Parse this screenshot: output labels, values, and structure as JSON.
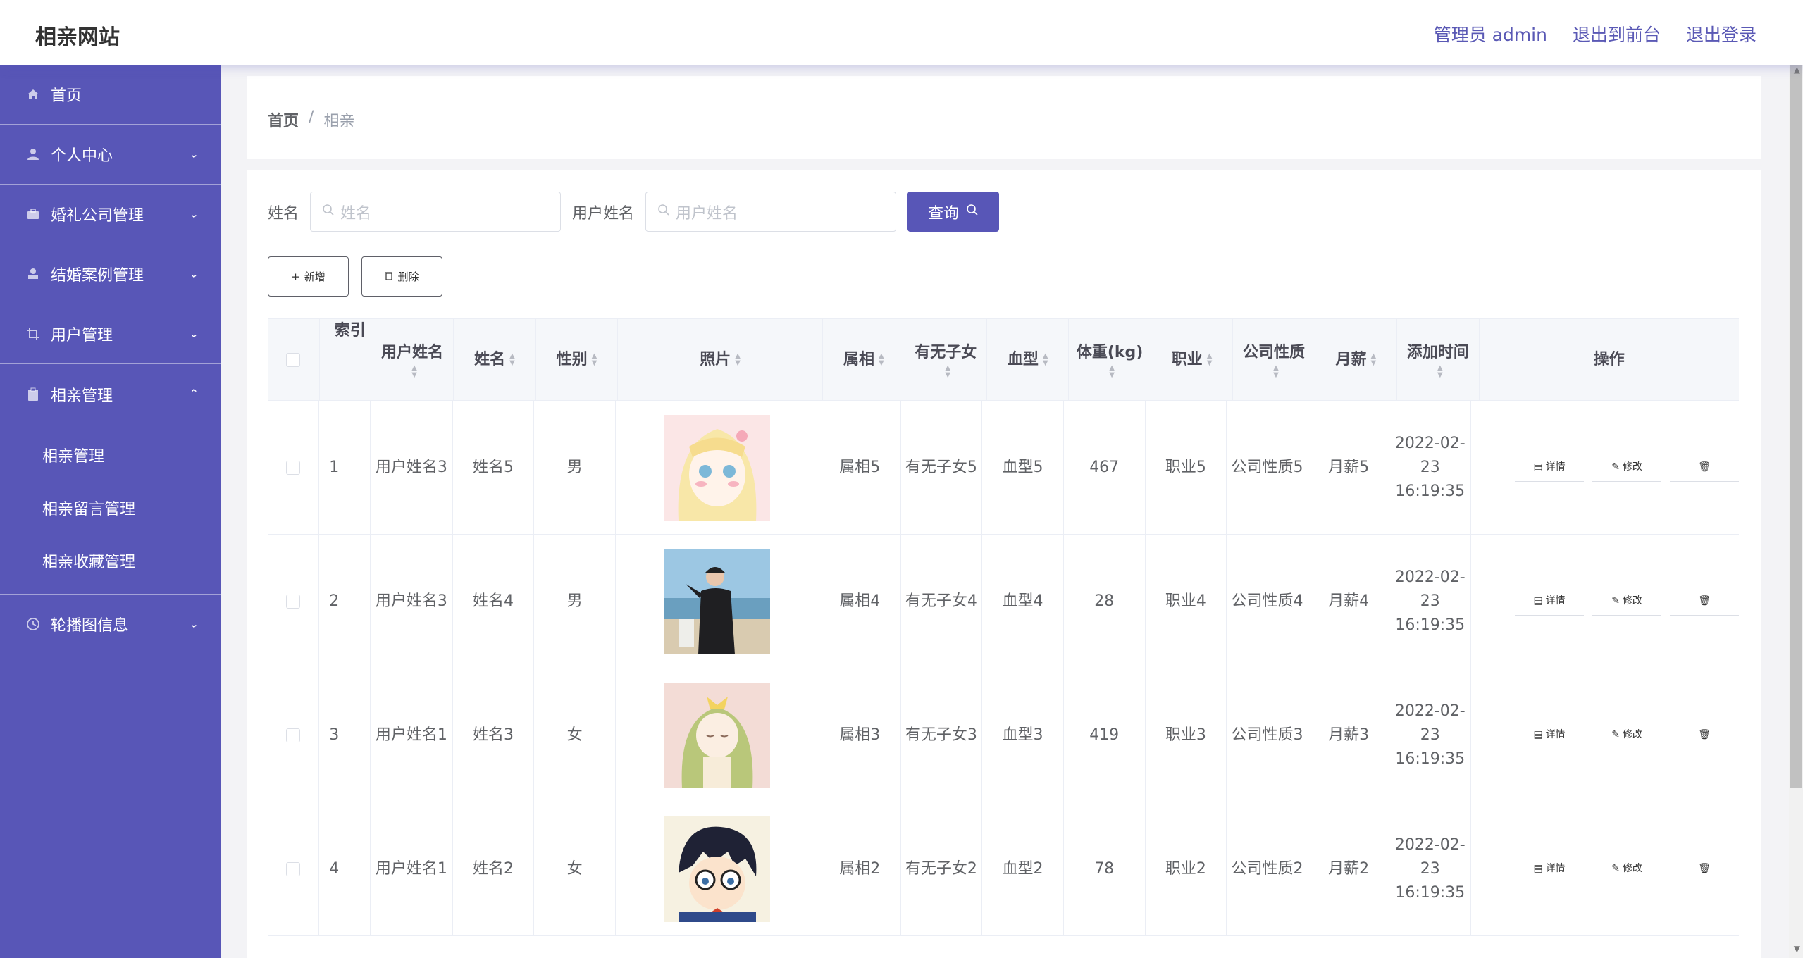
{
  "header": {
    "brand": "相亲网站",
    "admin": "管理员 admin",
    "front": "退出到前台",
    "logout": "退出登录"
  },
  "sidebar": {
    "items": [
      {
        "label": "首页",
        "icon": "home-icon"
      },
      {
        "label": "个人中心",
        "icon": "user-icon"
      },
      {
        "label": "婚礼公司管理",
        "icon": "briefcase-icon"
      },
      {
        "label": "结婚案例管理",
        "icon": "stamp-icon"
      },
      {
        "label": "用户管理",
        "icon": "crop-icon"
      },
      {
        "label": "相亲管理",
        "icon": "clipboard-icon"
      },
      {
        "label": "轮播图信息",
        "icon": "clock-icon"
      }
    ],
    "sub": [
      "相亲管理",
      "相亲留言管理",
      "相亲收藏管理"
    ]
  },
  "breadcrumb": {
    "home": "首页",
    "sep": "/",
    "current": "相亲"
  },
  "search": {
    "name_label": "姓名",
    "name_placeholder": "姓名",
    "user_label": "用户姓名",
    "user_placeholder": "用户姓名",
    "query_button": "查询"
  },
  "actions": {
    "add": "新增",
    "delete": "删除"
  },
  "table": {
    "headers": [
      "索引",
      "用户姓名",
      "姓名",
      "性别",
      "照片",
      "属相",
      "有无子女",
      "血型",
      "体重(kg)",
      "职业",
      "公司性质",
      "月薪",
      "添加时间",
      "操作"
    ],
    "op_labels": {
      "detail": "详情",
      "edit": "修改"
    },
    "rows": [
      {
        "idx": "1",
        "user": "用户姓名3",
        "name": "姓名5",
        "gender": "男",
        "zodiac": "属相5",
        "kids": "有无子女5",
        "blood": "血型5",
        "weight": "467",
        "job": "职业5",
        "company": "公司性质5",
        "salary": "月薪5",
        "time": "2022-02-23 16:19:35"
      },
      {
        "idx": "2",
        "user": "用户姓名3",
        "name": "姓名4",
        "gender": "男",
        "zodiac": "属相4",
        "kids": "有无子女4",
        "blood": "血型4",
        "weight": "28",
        "job": "职业4",
        "company": "公司性质4",
        "salary": "月薪4",
        "time": "2022-02-23 16:19:35"
      },
      {
        "idx": "3",
        "user": "用户姓名1",
        "name": "姓名3",
        "gender": "女",
        "zodiac": "属相3",
        "kids": "有无子女3",
        "blood": "血型3",
        "weight": "419",
        "job": "职业3",
        "company": "公司性质3",
        "salary": "月薪3",
        "time": "2022-02-23 16:19:35"
      },
      {
        "idx": "4",
        "user": "用户姓名1",
        "name": "姓名2",
        "gender": "女",
        "zodiac": "属相2",
        "kids": "有无子女2",
        "blood": "血型2",
        "weight": "78",
        "job": "职业2",
        "company": "公司性质2",
        "salary": "月薪2",
        "time": "2022-02-23 16:19:35"
      }
    ]
  },
  "colors": {
    "accent": "#5856b7",
    "sidebar": "#5856b7"
  }
}
